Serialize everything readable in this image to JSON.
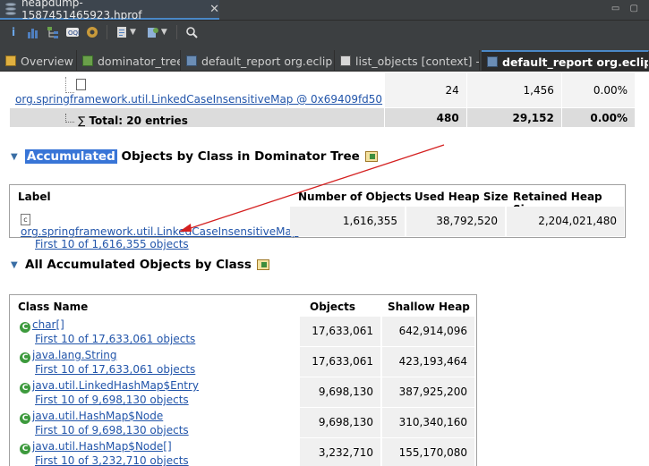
{
  "window": {
    "title_tab": "heapdump-1587451465923.hprof",
    "close_glyph": "✕"
  },
  "toolbar": {
    "buttons": [
      "info-icon",
      "histogram-icon",
      "dominator-tree-icon",
      "oql-icon",
      "heap-dump-overview-icon",
      "reports-icon",
      "query-browser-icon",
      "search-icon"
    ]
  },
  "editor_tabs": [
    {
      "label": "Overview"
    },
    {
      "label": "dominator_tree"
    },
    {
      "label": "default_report  org.eclip"
    },
    {
      "label": "list_objects  [context] -i"
    },
    {
      "label": "default_report  org.eclip"
    }
  ],
  "top_table": {
    "last_row": {
      "name": "org.springframework.util.LinkedCaseInsensitiveMap @ 0x69409fd50",
      "c1": "24",
      "c2": "1,456",
      "c3": "0.00%"
    },
    "total_row": {
      "label": "Total: 20 entries",
      "c1": "480",
      "c2": "29,152",
      "c3": "0.00%"
    }
  },
  "section1": {
    "title_highlight": "Accumulated",
    "title_rest": "Objects by Class in Dominator Tree",
    "headers": [
      "Label",
      "Number of Objects",
      "Used Heap Size",
      "Retained Heap Size"
    ],
    "row": {
      "class_name": "org.springframework.util.LinkedCaseInsensitiveMap",
      "link": "First 10 of 1,616,355 objects",
      "objects": "1,616,355",
      "used_heap": "38,792,520",
      "retained_heap": "2,204,021,480"
    }
  },
  "section2": {
    "title": "All Accumulated Objects by Class",
    "headers": [
      "Class Name",
      "Objects",
      "Shallow Heap"
    ],
    "rows": [
      {
        "class_name": "char[]",
        "link": "First 10 of 17,633,061 objects",
        "objects": "17,633,061",
        "shallow": "642,914,096"
      },
      {
        "class_name": "java.lang.String",
        "link": "First 10 of 17,633,061 objects",
        "objects": "17,633,061",
        "shallow": "423,193,464"
      },
      {
        "class_name": "java.util.LinkedHashMap$Entry",
        "link": "First 10 of 9,698,130 objects",
        "objects": "9,698,130",
        "shallow": "387,925,200"
      },
      {
        "class_name": "java.util.HashMap$Node",
        "link": "First 10 of 9,698,130 objects",
        "objects": "9,698,130",
        "shallow": "310,340,160"
      },
      {
        "class_name": "java.util.HashMap$Node[]",
        "link": "First 10 of 3,232,710 objects",
        "objects": "3,232,710",
        "shallow": "155,170,080"
      }
    ]
  },
  "annotation": {
    "arrow_color": "#d42020"
  }
}
